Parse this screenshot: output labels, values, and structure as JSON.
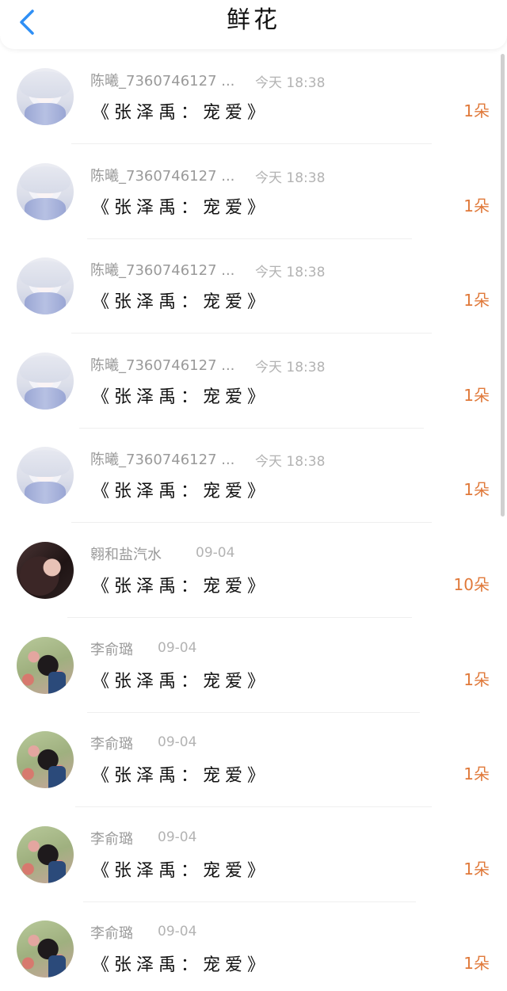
{
  "header": {
    "title": "鲜花",
    "back_icon": "chevron-left-icon",
    "accent": "#2f8ff5"
  },
  "colors": {
    "count": "#e0793a",
    "name": "#9a9a9a",
    "time": "#b3b3b3"
  },
  "items": [
    {
      "name": "陈曦_7360746127 ...",
      "time": "今天 18:38",
      "book": "《张泽禹：宠爱》",
      "count": "1朵",
      "avatar": "anime"
    },
    {
      "name": "陈曦_7360746127 ...",
      "time": "今天 18:38",
      "book": "《张泽禹：宠爱》",
      "count": "1朵",
      "avatar": "anime"
    },
    {
      "name": "陈曦_7360746127 ...",
      "time": "今天 18:38",
      "book": "《张泽禹：宠爱》",
      "count": "1朵",
      "avatar": "anime"
    },
    {
      "name": "陈曦_7360746127 ...",
      "time": "今天 18:38",
      "book": "《张泽禹：宠爱》",
      "count": "1朵",
      "avatar": "anime"
    },
    {
      "name": "陈曦_7360746127 ...",
      "time": "今天 18:38",
      "book": "《张泽禹：宠爱》",
      "count": "1朵",
      "avatar": "anime"
    },
    {
      "name": "翱和盐汽水",
      "time": "09-04",
      "book": "《张泽禹：宠爱》",
      "count": "10朵",
      "avatar": "dark"
    },
    {
      "name": "李俞璐",
      "time": "09-04",
      "book": "《张泽禹：宠爱》",
      "count": "1朵",
      "avatar": "flowers"
    },
    {
      "name": "李俞璐",
      "time": "09-04",
      "book": "《张泽禹：宠爱》",
      "count": "1朵",
      "avatar": "flowers"
    },
    {
      "name": "李俞璐",
      "time": "09-04",
      "book": "《张泽禹：宠爱》",
      "count": "1朵",
      "avatar": "flowers"
    },
    {
      "name": "李俞璐",
      "time": "09-04",
      "book": "《张泽禹：宠爱》",
      "count": "1朵",
      "avatar": "flowers"
    }
  ]
}
